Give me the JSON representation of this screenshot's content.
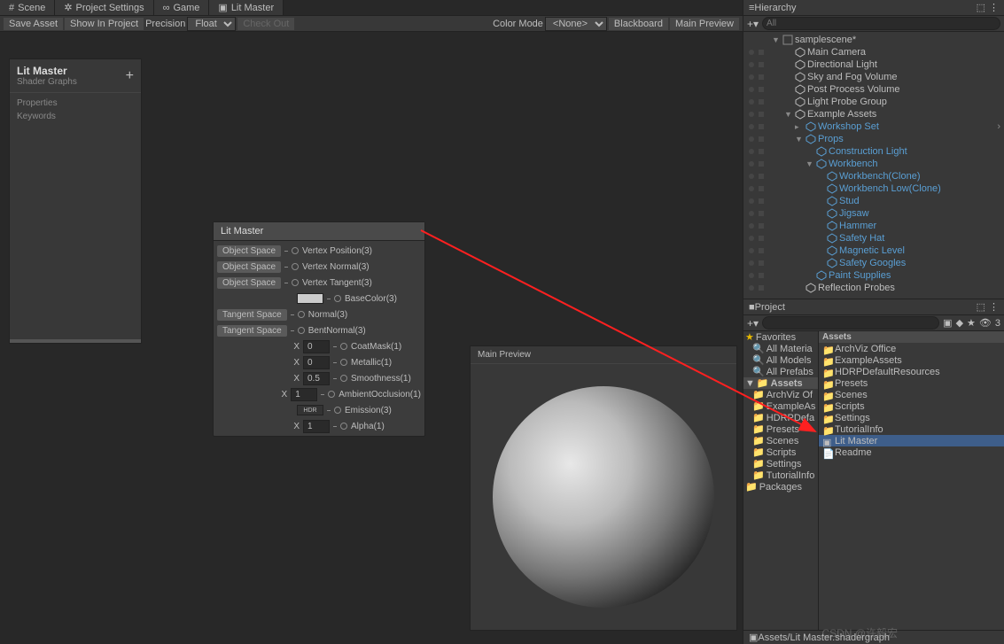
{
  "tabs": [
    {
      "label": "Scene",
      "icon": "grid"
    },
    {
      "label": "Project Settings",
      "icon": "gear"
    },
    {
      "label": "Game",
      "icon": "gamepad"
    },
    {
      "label": "Lit Master",
      "icon": "shader",
      "active": true
    }
  ],
  "toolbar": {
    "save_asset": "Save Asset",
    "show_in_project": "Show In Project",
    "precision": "Precision",
    "precision_value": "Float",
    "check_out": "Check Out",
    "color_mode": "Color Mode",
    "color_mode_value": "<None>",
    "blackboard": "Blackboard",
    "main_preview": "Main Preview"
  },
  "blackboard": {
    "title": "Lit Master",
    "subtitle": "Shader Graphs",
    "items": [
      "Properties",
      "Keywords"
    ]
  },
  "node": {
    "title": "Lit Master",
    "rows": [
      {
        "left": "Object Space",
        "port": true,
        "label": "Vertex Position(3)"
      },
      {
        "left": "Object Space",
        "port": true,
        "label": "Vertex Normal(3)"
      },
      {
        "left": "Object Space",
        "port": true,
        "label": "Vertex Tangent(3)"
      },
      {
        "swatch": "#cccccc",
        "port": true,
        "label": "BaseColor(3)"
      },
      {
        "left": "Tangent Space",
        "port": true,
        "label": "Normal(3)"
      },
      {
        "left": "Tangent Space",
        "port": true,
        "label": "BentNormal(3)"
      },
      {
        "x": "X",
        "value": "0",
        "port": true,
        "label": "CoatMask(1)"
      },
      {
        "x": "X",
        "value": "0",
        "port": true,
        "label": "Metallic(1)"
      },
      {
        "x": "X",
        "value": "0.5",
        "port": true,
        "label": "Smoothness(1)"
      },
      {
        "x": "X",
        "value": "1",
        "port": true,
        "label": "AmbientOcclusion(1)"
      },
      {
        "hdr": "HDR",
        "port": true,
        "label": "Emission(3)"
      },
      {
        "x": "X",
        "value": "1",
        "port": true,
        "label": "Alpha(1)"
      }
    ]
  },
  "preview": {
    "title": "Main Preview"
  },
  "hierarchy": {
    "title": "Hierarchy",
    "search_placeholder": "All",
    "items": [
      {
        "label": "samplescene*",
        "type": "scene",
        "indent": 0,
        "expanded": true
      },
      {
        "label": "Main Camera",
        "type": "obj",
        "indent": 1
      },
      {
        "label": "Directional Light",
        "type": "obj",
        "indent": 1
      },
      {
        "label": "Sky and Fog Volume",
        "type": "obj",
        "indent": 1
      },
      {
        "label": "Post Process Volume",
        "type": "obj",
        "indent": 1
      },
      {
        "label": "Light Probe Group",
        "type": "obj",
        "indent": 1
      },
      {
        "label": "Example Assets",
        "type": "obj",
        "indent": 1,
        "expanded": true
      },
      {
        "label": "Workshop Set",
        "type": "prefab",
        "indent": 2,
        "link": true,
        "arrow": true
      },
      {
        "label": "Props",
        "type": "prefab",
        "indent": 2,
        "link": true,
        "expanded": true
      },
      {
        "label": "Construction Light",
        "type": "prefab",
        "indent": 3,
        "link": true
      },
      {
        "label": "Workbench",
        "type": "prefab",
        "indent": 3,
        "link": true,
        "expanded": true
      },
      {
        "label": "Workbench(Clone)",
        "type": "prefab",
        "indent": 4,
        "link": true
      },
      {
        "label": "Workbench Low(Clone)",
        "type": "prefab",
        "indent": 4,
        "link": true
      },
      {
        "label": "Stud",
        "type": "prefab",
        "indent": 4,
        "link": true
      },
      {
        "label": "Jigsaw",
        "type": "prefab",
        "indent": 4,
        "link": true
      },
      {
        "label": "Hammer",
        "type": "prefab",
        "indent": 4,
        "link": true
      },
      {
        "label": "Safety Hat",
        "type": "prefab",
        "indent": 4,
        "link": true
      },
      {
        "label": "Magnetic Level",
        "type": "prefab",
        "indent": 4,
        "link": true
      },
      {
        "label": "Safety Googles",
        "type": "prefab",
        "indent": 4,
        "link": true
      },
      {
        "label": "Paint Supplies",
        "type": "prefab",
        "indent": 3,
        "link": true
      },
      {
        "label": "Reflection Probes",
        "type": "obj",
        "indent": 2
      }
    ]
  },
  "project": {
    "title": "Project",
    "search_placeholder": "",
    "favorites_label": "Favorites",
    "favorites": [
      "All Materia",
      "All Models",
      "All Prefabs"
    ],
    "folders_header": "Assets",
    "folders": [
      "ArchViz Of",
      "ExampleAs",
      "HDRPDefa",
      "Presets",
      "Scenes",
      "Scripts",
      "Settings",
      "TutorialInfo"
    ],
    "packages_label": "Packages",
    "list_header": "Assets",
    "assets": [
      {
        "label": "ArchViz Office",
        "type": "folder"
      },
      {
        "label": "ExampleAssets",
        "type": "folder"
      },
      {
        "label": "HDRPDefaultResources",
        "type": "folder"
      },
      {
        "label": "Presets",
        "type": "folder"
      },
      {
        "label": "Scenes",
        "type": "folder"
      },
      {
        "label": "Scripts",
        "type": "folder"
      },
      {
        "label": "Settings",
        "type": "folder"
      },
      {
        "label": "TutorialInfo",
        "type": "folder"
      },
      {
        "label": "Lit Master",
        "type": "shader",
        "selected": true
      },
      {
        "label": "Readme",
        "type": "asset"
      }
    ],
    "footer": "Assets/Lit Master.shadergraph",
    "slider_icon": "3"
  },
  "watermark": "CSDN @许毅宏"
}
